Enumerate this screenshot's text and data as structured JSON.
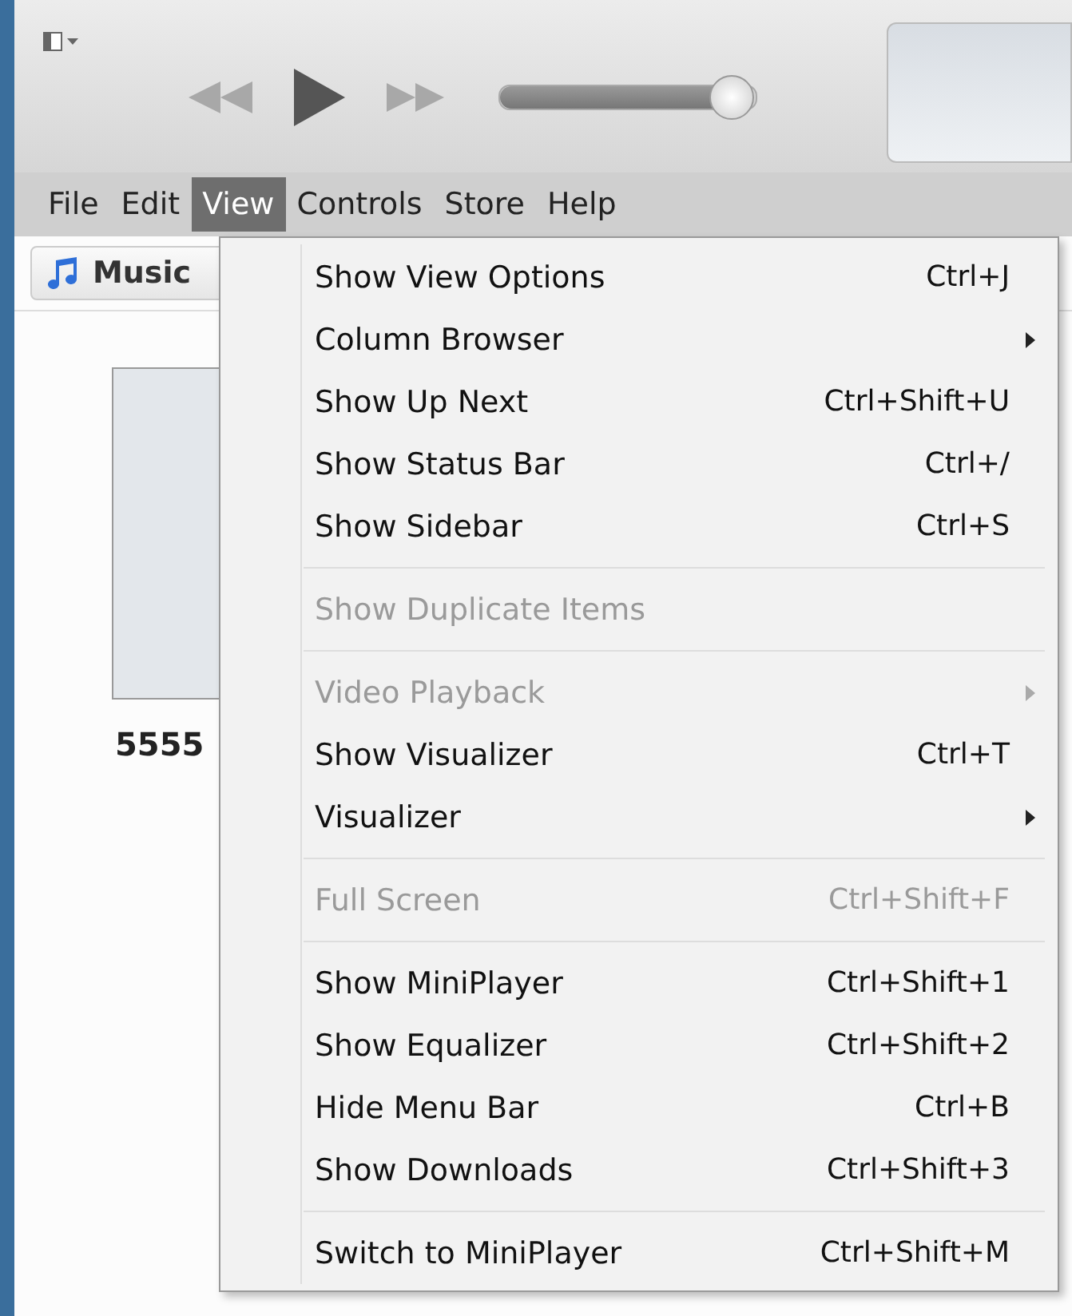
{
  "player": {
    "volume": {
      "level": 0.9
    }
  },
  "menu_bar": [
    {
      "label": "File",
      "selected": false
    },
    {
      "label": "Edit",
      "selected": false
    },
    {
      "label": "View",
      "selected": true
    },
    {
      "label": "Controls",
      "selected": false
    },
    {
      "label": "Store",
      "selected": false
    },
    {
      "label": "Help",
      "selected": false
    }
  ],
  "library_button": {
    "label": "Music"
  },
  "album": {
    "title": "5555"
  },
  "view_menu": {
    "sections": [
      [
        {
          "label": "Show View Options",
          "shortcut": "Ctrl+J",
          "submenu": false,
          "disabled": false
        },
        {
          "label": "Column Browser",
          "submenu": true,
          "disabled": false
        },
        {
          "label": "Show Up Next",
          "shortcut": "Ctrl+Shift+U",
          "submenu": false,
          "disabled": false
        },
        {
          "label": "Show Status Bar",
          "shortcut": "Ctrl+/",
          "submenu": false,
          "disabled": false
        },
        {
          "label": "Show Sidebar",
          "shortcut": "Ctrl+S",
          "submenu": false,
          "disabled": false
        }
      ],
      [
        {
          "label": "Show Duplicate Items",
          "submenu": false,
          "disabled": true
        }
      ],
      [
        {
          "label": "Video Playback",
          "submenu": true,
          "disabled": true
        },
        {
          "label": "Show Visualizer",
          "shortcut": "Ctrl+T",
          "submenu": false,
          "disabled": false
        },
        {
          "label": "Visualizer",
          "submenu": true,
          "disabled": false
        }
      ],
      [
        {
          "label": "Full Screen",
          "shortcut": "Ctrl+Shift+F",
          "submenu": false,
          "disabled": true
        }
      ],
      [
        {
          "label": "Show MiniPlayer",
          "shortcut": "Ctrl+Shift+1",
          "submenu": false,
          "disabled": false
        },
        {
          "label": "Show Equalizer",
          "shortcut": "Ctrl+Shift+2",
          "submenu": false,
          "disabled": false
        },
        {
          "label": "Hide Menu Bar",
          "shortcut": "Ctrl+B",
          "submenu": false,
          "disabled": false
        },
        {
          "label": "Show Downloads",
          "shortcut": "Ctrl+Shift+3",
          "submenu": false,
          "disabled": false
        }
      ],
      [
        {
          "label": "Switch to MiniPlayer",
          "shortcut": "Ctrl+Shift+M",
          "submenu": false,
          "disabled": false
        }
      ]
    ]
  }
}
